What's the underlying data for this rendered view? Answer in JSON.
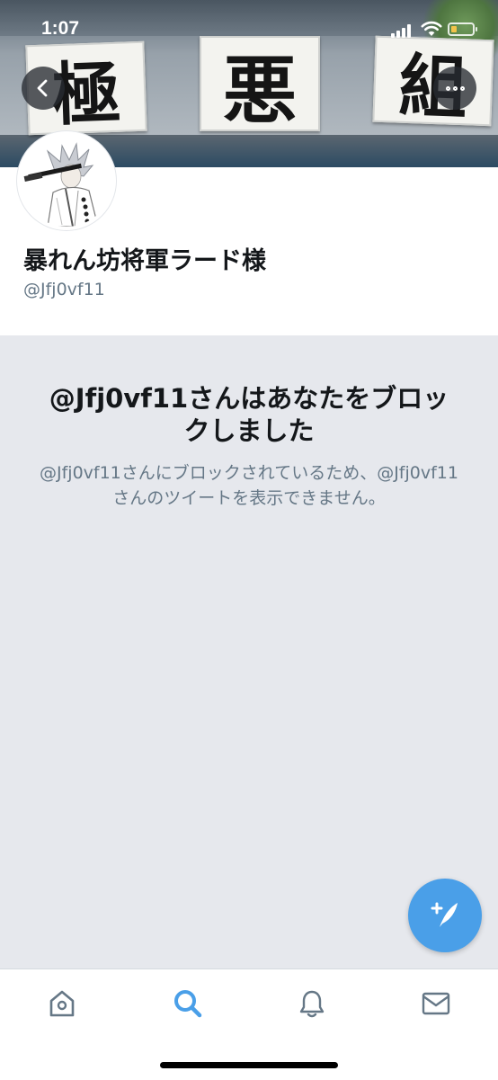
{
  "status_bar": {
    "time": "1:07"
  },
  "banner": {
    "signs": [
      "極",
      "悪",
      "組"
    ]
  },
  "profile": {
    "display_name": "暴れん坊将軍ラード様",
    "handle": "@Jfj0vf11"
  },
  "blocked_notice": {
    "title": "@Jfj0vf11さんはあなたをブロックしました",
    "description": "@Jfj0vf11さんにブロックされているため、@Jfj0vf11さんのツイートを表示できません。"
  },
  "colors": {
    "accent": "#4a9fe8",
    "text_primary": "#14171a",
    "text_secondary": "#657786",
    "background": "#e6e8ed"
  },
  "icons": {
    "back": "chevron-left-icon",
    "more": "more-horizontal-icon",
    "compose": "compose-tweet-icon",
    "tabs": [
      "home-icon",
      "search-icon",
      "bell-icon",
      "mail-icon"
    ]
  }
}
